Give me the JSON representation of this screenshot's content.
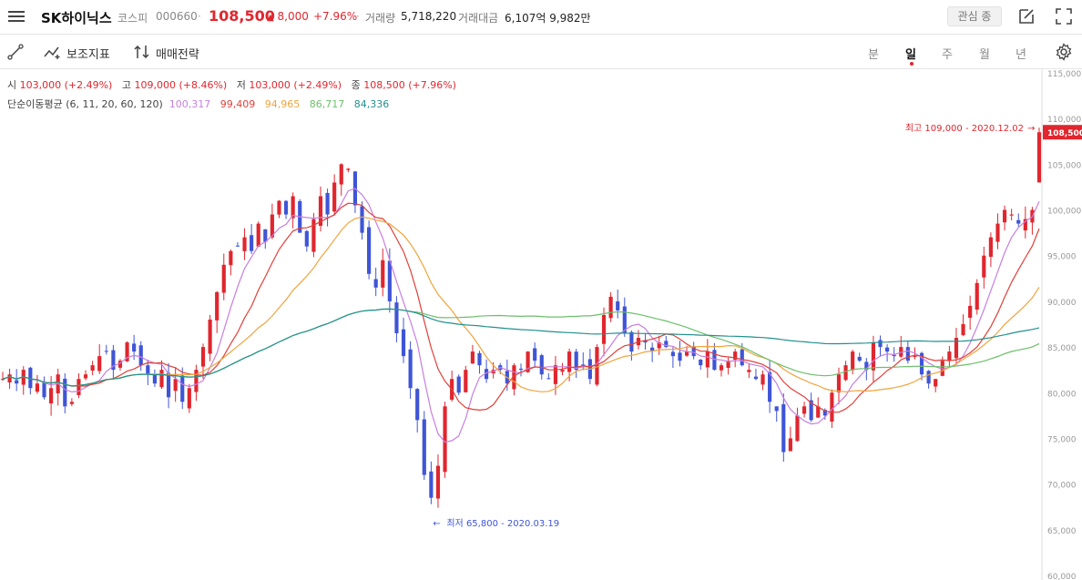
{
  "header": {
    "stock_name": "SK하이닉스",
    "market": "코스피",
    "code": "000660",
    "sep": "·",
    "price": "108,500",
    "change": "8,000",
    "change_arrow": "▲",
    "change_pct": "+7.96%",
    "volume_label": "거래량",
    "volume_value": "5,718,220",
    "amount_label": "거래대금",
    "amount_value": "6,107억 9,982만",
    "favorite_label": "관심 종"
  },
  "toolbar": {
    "indicator_label": "보조지표",
    "strategy_label": "매매전략",
    "periods": [
      "분",
      "일",
      "주",
      "월",
      "년"
    ],
    "active_period": "일"
  },
  "ohlc_info": {
    "open_label": "시",
    "open_value": "103,000 (+2.49%)",
    "high_label": "고",
    "high_value": "109,000 (+8.46%)",
    "low_label": "저",
    "low_value": "103,000 (+2.49%)",
    "close_label": "종",
    "close_value": "108,500 (+7.96%)"
  },
  "ma_info": {
    "label": "단순이동평균 (6, 11, 20, 60, 120)",
    "values": [
      {
        "value": "100,317",
        "color": "#c77fe0"
      },
      {
        "value": "99,409",
        "color": "#e0403a"
      },
      {
        "value": "94,965",
        "color": "#f0a43c"
      },
      {
        "value": "86,717",
        "color": "#6cbf6a"
      },
      {
        "value": "84,336",
        "color": "#22908f"
      }
    ]
  },
  "chart_data": {
    "type": "candlestick",
    "y_axis": {
      "min": 60000,
      "max": 115000,
      "ticks": [
        "115,000",
        "110,000",
        "105,000",
        "100,000",
        "95,000",
        "90,000",
        "85,000",
        "80,000",
        "75,000",
        "70,000",
        "65,000",
        "60,000"
      ]
    },
    "current_price_tag": "108,500",
    "high_annotation": "최고 109,000 - 2020.12.02",
    "low_annotation": "최저 65,800 - 2020.03.19",
    "colors": {
      "up": "#e0262e",
      "down": "#3f55d6"
    },
    "closes": [
      81500,
      82000,
      81000,
      82500,
      80500,
      81000,
      79500,
      80500,
      82000,
      78500,
      79000,
      81500,
      82000,
      83000,
      84000,
      84500,
      82500,
      83500,
      85500,
      84500,
      83000,
      82000,
      81000,
      82500,
      79500,
      81500,
      79000,
      80500,
      82500,
      85000,
      88000,
      91000,
      94000,
      95500,
      96000,
      97000,
      95500,
      98500,
      96500,
      99500,
      101000,
      99500,
      101500,
      97500,
      96000,
      99000,
      101500,
      99500,
      103000,
      105000,
      104500,
      100500,
      97500,
      93000,
      91500,
      94500,
      90000,
      86500,
      84000,
      80500,
      77000,
      71000,
      68500,
      72000,
      78500,
      81500,
      80000,
      82500,
      84500,
      83000,
      81500,
      82500,
      82500,
      81000,
      83000,
      82500,
      84500,
      83500,
      82000,
      81500,
      83000,
      82500,
      84500,
      82500,
      83000,
      81500,
      85000,
      88500,
      90500,
      89000,
      86500,
      84500,
      86000,
      85500,
      84500,
      85500,
      85000,
      84000,
      83500,
      84500,
      84000,
      83000,
      84500,
      82500,
      83000,
      83500,
      84500,
      83000,
      82500,
      81500,
      82000,
      79000,
      78000,
      73500,
      75000,
      77500,
      78500,
      77000,
      78500,
      77500,
      80000,
      82000,
      83000,
      84500,
      83500,
      82500,
      85500,
      85000,
      84500,
      84000,
      85000,
      83500,
      84000,
      82000,
      81000,
      81500,
      83500,
      84500,
      86000,
      87500,
      89500,
      92000,
      95000,
      97000,
      98500,
      100000,
      99500,
      98500,
      99000,
      100000,
      108500
    ]
  }
}
